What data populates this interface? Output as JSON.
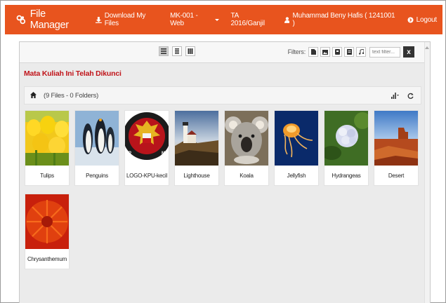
{
  "navbar": {
    "brand": "File Manager",
    "download": "Download My Files",
    "course": "MK-001 - Web",
    "term": "TA 2016/Ganjil",
    "user": "Muhammad Beny Hafis ( 1241001 )",
    "logout": "Logout",
    "color": "#e8541e"
  },
  "toolbar": {
    "filters_label": "Filters:",
    "filter_placeholder": "text filter...",
    "clear": "x"
  },
  "notice": "Mata Kuliah Ini Telah Dikunci",
  "path": {
    "count": "(9 Files - 0 Folders)"
  },
  "files": [
    {
      "name": "Tulips"
    },
    {
      "name": "Penguins"
    },
    {
      "name": "LOGO-KPU-kecil"
    },
    {
      "name": "Lighthouse"
    },
    {
      "name": "Koala"
    },
    {
      "name": "Jellyfish"
    },
    {
      "name": "Hydrangeas"
    },
    {
      "name": "Desert"
    },
    {
      "name": "Chrysanthemum"
    }
  ]
}
